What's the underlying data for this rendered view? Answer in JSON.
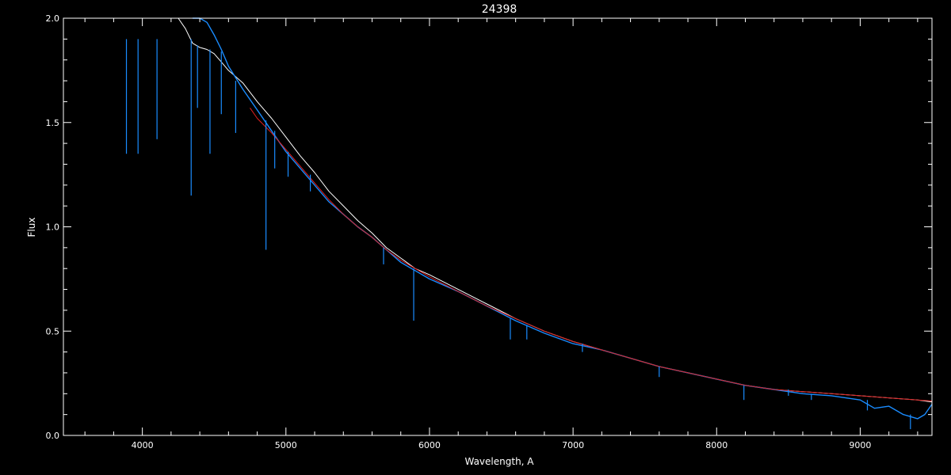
{
  "chart_data": {
    "type": "line",
    "title": "24398",
    "xlabel": "Wavelength, A",
    "ylabel": "Flux",
    "xlim": [
      3450,
      9500
    ],
    "ylim": [
      0.0,
      2.0
    ],
    "x_ticks": [
      "4000",
      "5000",
      "6000",
      "7000",
      "8000",
      "9000"
    ],
    "y_ticks": [
      "0.0",
      "0.5",
      "1.0",
      "1.5",
      "2.0"
    ],
    "grid": false,
    "colors": {
      "observed_white": "#ffffff",
      "observed_blue": "#1a8cff",
      "model_red": "#e02020",
      "axes": "#ffffff",
      "background": "#000000"
    },
    "series": [
      {
        "color": "#ffffff",
        "x": [
          4250,
          4300,
          4350,
          4400,
          4450,
          4500,
          4550,
          4600,
          4700,
          4800,
          4900,
          5000,
          5100,
          5200,
          5300,
          5400,
          5500,
          5600,
          5700,
          5800,
          5900,
          6000,
          6200,
          6400,
          6600,
          6800,
          7000,
          7200,
          7400,
          7600,
          7800,
          8000,
          8200,
          8400,
          8600,
          8800,
          9000,
          9200,
          9400,
          9500
        ],
        "y": [
          2.0,
          1.95,
          1.88,
          1.86,
          1.85,
          1.83,
          1.79,
          1.75,
          1.69,
          1.6,
          1.52,
          1.43,
          1.34,
          1.26,
          1.17,
          1.1,
          1.03,
          0.97,
          0.9,
          0.85,
          0.8,
          0.77,
          0.7,
          0.63,
          0.56,
          0.5,
          0.45,
          0.41,
          0.37,
          0.33,
          0.3,
          0.27,
          0.24,
          0.22,
          0.21,
          0.2,
          0.19,
          0.18,
          0.17,
          0.16
        ]
      },
      {
        "color": "#1a8cff",
        "x": [
          4350,
          4400,
          4450,
          4500,
          4550,
          4600,
          4700,
          4800,
          4900,
          5000,
          5100,
          5200,
          5300,
          5400,
          5500,
          5600,
          5700,
          5800,
          5900,
          6000,
          6200,
          6400,
          6600,
          6800,
          7000,
          7200,
          7400,
          7600,
          7800,
          8000,
          8200,
          8400,
          8600,
          8800,
          9000,
          9100,
          9200,
          9300,
          9400,
          9450,
          9500
        ],
        "y": [
          2.0,
          2.0,
          1.98,
          1.92,
          1.85,
          1.77,
          1.66,
          1.56,
          1.46,
          1.36,
          1.28,
          1.2,
          1.12,
          1.06,
          1.0,
          0.95,
          0.89,
          0.83,
          0.79,
          0.75,
          0.69,
          0.62,
          0.55,
          0.49,
          0.44,
          0.41,
          0.37,
          0.33,
          0.3,
          0.27,
          0.24,
          0.22,
          0.2,
          0.19,
          0.17,
          0.13,
          0.14,
          0.1,
          0.08,
          0.1,
          0.15
        ]
      },
      {
        "color": "#e02020",
        "x": [
          4750,
          4800,
          4900,
          5000,
          5100,
          5200,
          5300,
          5400,
          5500,
          5600,
          5700,
          5800,
          5900,
          6000,
          6200,
          6400,
          6600,
          6800,
          7000,
          7200,
          7400,
          7600,
          7800,
          8000,
          8200,
          8400,
          8600,
          8800,
          9000,
          9200,
          9400,
          9500
        ],
        "y": [
          1.57,
          1.52,
          1.45,
          1.37,
          1.29,
          1.21,
          1.13,
          1.06,
          1.0,
          0.95,
          0.89,
          0.84,
          0.8,
          0.76,
          0.69,
          0.62,
          0.56,
          0.5,
          0.45,
          0.41,
          0.37,
          0.33,
          0.3,
          0.27,
          0.24,
          0.22,
          0.21,
          0.2,
          0.19,
          0.18,
          0.17,
          0.165
        ]
      },
      {
        "color": "#1a8cff",
        "x": [
          3450,
          9500
        ],
        "y": [
          0.0,
          0.0
        ]
      }
    ],
    "absorption_lines": [
      {
        "x": 3889,
        "y": 1.9,
        "depth": 0.55
      },
      {
        "x": 3970,
        "y": 1.9,
        "depth": 0.55
      },
      {
        "x": 4102,
        "y": 1.9,
        "depth": 0.48
      },
      {
        "x": 4340,
        "y": 1.9,
        "depth": 0.75
      },
      {
        "x": 4384,
        "y": 1.87,
        "depth": 0.3
      },
      {
        "x": 4471,
        "y": 1.85,
        "depth": 0.5
      },
      {
        "x": 4550,
        "y": 1.84,
        "depth": 0.3
      },
      {
        "x": 4650,
        "y": 1.7,
        "depth": 0.25
      },
      {
        "x": 4861,
        "y": 1.51,
        "depth": 0.62
      },
      {
        "x": 4922,
        "y": 1.46,
        "depth": 0.18
      },
      {
        "x": 5015,
        "y": 1.36,
        "depth": 0.12
      },
      {
        "x": 5170,
        "y": 1.25,
        "depth": 0.08
      },
      {
        "x": 5680,
        "y": 0.9,
        "depth": 0.08
      },
      {
        "x": 5890,
        "y": 0.8,
        "depth": 0.25
      },
      {
        "x": 6563,
        "y": 0.56,
        "depth": 0.1
      },
      {
        "x": 6678,
        "y": 0.53,
        "depth": 0.07
      },
      {
        "x": 7065,
        "y": 0.44,
        "depth": 0.04
      },
      {
        "x": 7600,
        "y": 0.33,
        "depth": 0.05
      },
      {
        "x": 8190,
        "y": 0.24,
        "depth": 0.07
      },
      {
        "x": 8500,
        "y": 0.22,
        "depth": 0.03
      },
      {
        "x": 8660,
        "y": 0.2,
        "depth": 0.03
      },
      {
        "x": 9050,
        "y": 0.17,
        "depth": 0.05
      },
      {
        "x": 9350,
        "y": 0.1,
        "depth": 0.07
      }
    ]
  }
}
